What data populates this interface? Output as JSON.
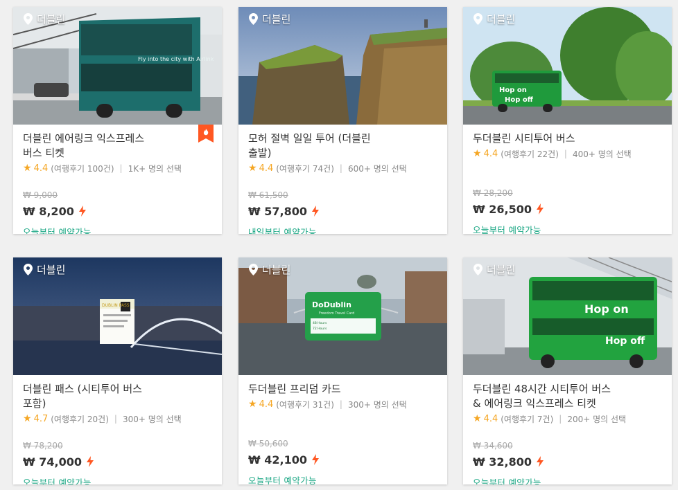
{
  "location_label": "더블린",
  "cards": [
    {
      "title_line1": "더블린 에어링크 익스프레스",
      "title_line2": "버스 티켓",
      "rating": "4.4",
      "reviews": "(여행후기 100건)",
      "booked": "1K+ 명의 선택",
      "original_price": "₩ 9,000",
      "price": "₩ 8,200",
      "availability": "오늘부터 예약가능",
      "badge": "fire-badge-icon"
    },
    {
      "title_line1": "모허 절벽 일일 투어 (더블린",
      "title_line2": "출발)",
      "rating": "4.4",
      "reviews": "(여행후기 74건)",
      "booked": "600+ 명의 선택",
      "original_price": "₩ 61,500",
      "price": "₩ 57,800",
      "availability": "내일부터 예약가능"
    },
    {
      "title_line1": "두더블린 시티투어 버스",
      "title_line2": "",
      "rating": "4.4",
      "reviews": "(여행후기 22건)",
      "booked": "400+ 명의 선택",
      "original_price": "₩ 28,200",
      "price": "₩ 26,500",
      "availability": "오늘부터 예약가능"
    },
    {
      "title_line1": "더블린 패스 (시티투어 버스",
      "title_line2": "포함)",
      "rating": "4.7",
      "reviews": "(여행후기 20건)",
      "booked": "300+ 명의 선택",
      "original_price": "₩ 78,200",
      "price": "₩ 74,000",
      "availability": "오늘부터 예약가능"
    },
    {
      "title_line1": "두더블린 프리덤 카드",
      "title_line2": "",
      "rating": "4.4",
      "reviews": "(여행후기 31건)",
      "booked": "300+ 명의 선택",
      "original_price": "₩ 50,600",
      "price": "₩ 42,100",
      "availability": "오늘부터 예약가능"
    },
    {
      "title_line1": "두더블린 48시간 시티투어 버스",
      "title_line2": "& 에어링크 익스프레스 티켓",
      "rating": "4.4",
      "reviews": "(여행후기 7건)",
      "booked": "200+ 명의 선택",
      "original_price": "₩ 34,600",
      "price": "₩ 32,800",
      "availability": "오늘부터 예약가능"
    }
  ],
  "images": {
    "card0": {
      "bus_text": "Fly into the city with Airlink"
    },
    "card2": {
      "bus_text_1": "Hop on",
      "bus_text_2": "Hop off"
    },
    "card3": {
      "pass_text": "DUBLIN PASS"
    },
    "card4": {
      "card_brand": "DoDublin",
      "card_subtitle": "Freedom Travel Card",
      "card_hours": "48 Hours",
      "card_hours2": "72 Hours"
    },
    "card5": {
      "bus_text_1": "Hop on",
      "bus_text_2": "Hop off"
    }
  },
  "colors": {
    "accent_green": "#1ba784",
    "star": "#f5a623",
    "bolt": "#ff5722",
    "badge": "#ff5722"
  }
}
